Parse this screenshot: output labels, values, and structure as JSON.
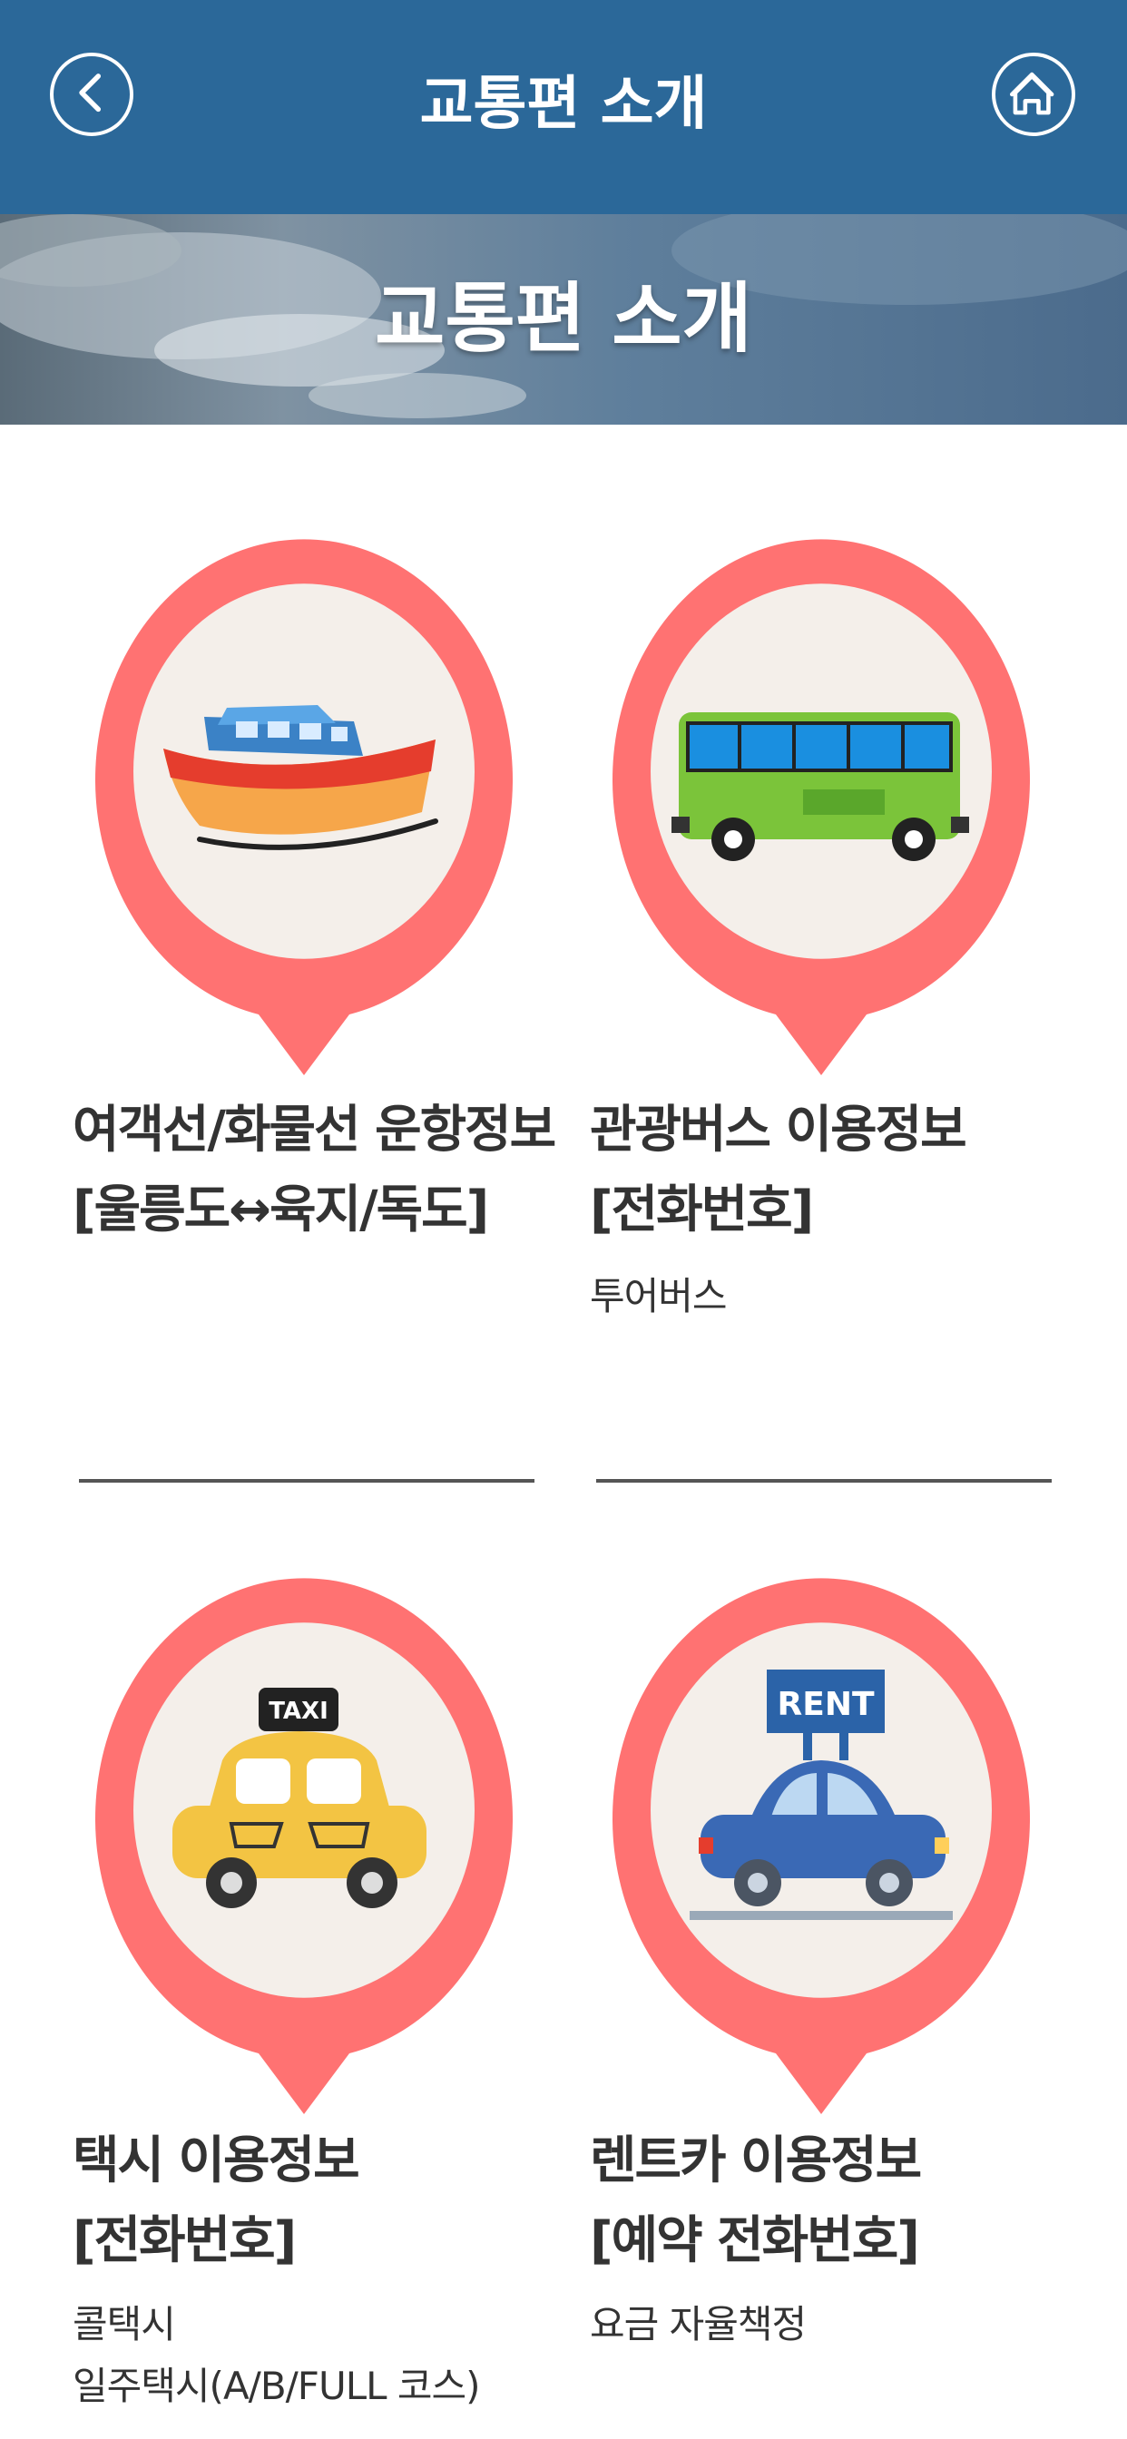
{
  "header": {
    "title": "교통편 소개",
    "back_icon": "chevron-left-icon",
    "home_icon": "home-icon",
    "color": "#2b6899"
  },
  "banner": {
    "title": "교통편 소개"
  },
  "accent_color": "#ff7272",
  "cards": [
    {
      "icon": "ship-icon",
      "title_line1": "여객선/화물선 운항정보",
      "title_line2": "[울릉도↔육지/독도]",
      "subs": []
    },
    {
      "icon": "bus-icon",
      "title_line1": "관광버스 이용정보",
      "title_line2": "[전화번호]",
      "subs": [
        "투어버스"
      ]
    },
    {
      "icon": "taxi-icon",
      "icon_label": "TAXI",
      "title_line1": "택시 이용정보",
      "title_line2": "[전화번호]",
      "subs": [
        "콜택시",
        "일주택시(A/B/FULL 코스)"
      ]
    },
    {
      "icon": "rent-car-icon",
      "icon_label": "RENT",
      "title_line1": "렌트카 이용정보",
      "title_line2": "[예약 전화번호]",
      "subs": [
        "요금 자율책정"
      ]
    }
  ]
}
